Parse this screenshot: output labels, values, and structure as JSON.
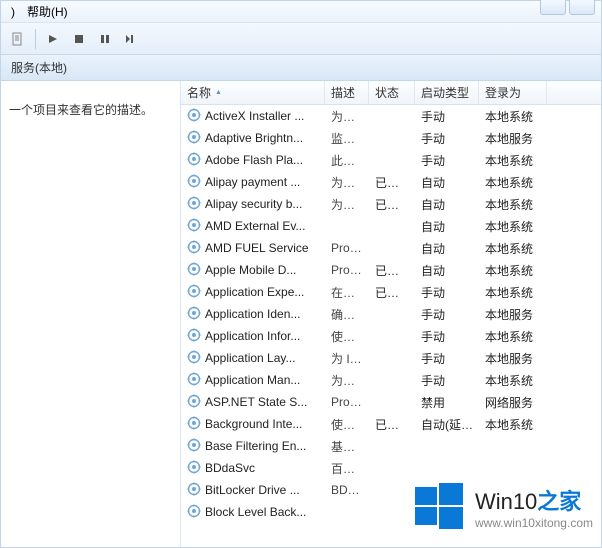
{
  "menu": {
    "item_right": ")",
    "help": "帮助(H)"
  },
  "toolbar": {
    "icons": [
      "doc-icon",
      "sep",
      "play-icon",
      "stop-icon",
      "pause-icon",
      "restart-icon"
    ]
  },
  "panel_title": "服务(本地)",
  "left_hint": "一个项目来查看它的描述。",
  "columns": {
    "name": "名称",
    "desc": "描述",
    "status": "状态",
    "startup": "启动类型",
    "logon": "登录为"
  },
  "services": [
    {
      "name": "ActiveX Installer ...",
      "desc": "为从...",
      "status": "",
      "startup": "手动",
      "logon": "本地系统"
    },
    {
      "name": "Adaptive Brightn...",
      "desc": "监视...",
      "status": "",
      "startup": "手动",
      "logon": "本地服务"
    },
    {
      "name": "Adobe Flash Pla...",
      "desc": "此服...",
      "status": "",
      "startup": "手动",
      "logon": "本地系统"
    },
    {
      "name": "Alipay payment ...",
      "desc": "为支...",
      "status": "已启动",
      "startup": "自动",
      "logon": "本地系统"
    },
    {
      "name": "Alipay security b...",
      "desc": "为支...",
      "status": "已启动",
      "startup": "自动",
      "logon": "本地系统"
    },
    {
      "name": "AMD External Ev...",
      "desc": "",
      "status": "",
      "startup": "自动",
      "logon": "本地系统"
    },
    {
      "name": "AMD FUEL Service",
      "desc": "Prov...",
      "status": "",
      "startup": "自动",
      "logon": "本地系统"
    },
    {
      "name": "Apple Mobile D...",
      "desc": "Prov...",
      "status": "已启动",
      "startup": "自动",
      "logon": "本地系统"
    },
    {
      "name": "Application Expe...",
      "desc": "在应...",
      "status": "已启动",
      "startup": "手动",
      "logon": "本地系统"
    },
    {
      "name": "Application Iden...",
      "desc": "确定...",
      "status": "",
      "startup": "手动",
      "logon": "本地服务"
    },
    {
      "name": "Application Infor...",
      "desc": "使用...",
      "status": "",
      "startup": "手动",
      "logon": "本地系统"
    },
    {
      "name": "Application Lay...",
      "desc": "为 In...",
      "status": "",
      "startup": "手动",
      "logon": "本地服务"
    },
    {
      "name": "Application Man...",
      "desc": "为通...",
      "status": "",
      "startup": "手动",
      "logon": "本地系统"
    },
    {
      "name": "ASP.NET State S...",
      "desc": "Prov...",
      "status": "",
      "startup": "禁用",
      "logon": "网络服务"
    },
    {
      "name": "Background Inte...",
      "desc": "使用...",
      "status": "已启动",
      "startup": "自动(延迟...",
      "logon": "本地系统"
    },
    {
      "name": "Base Filtering En...",
      "desc": "基本...",
      "status": "",
      "startup": "",
      "logon": ""
    },
    {
      "name": "BDdaSvc",
      "desc": "百度...",
      "status": "",
      "startup": "",
      "logon": ""
    },
    {
      "name": "BitLocker Drive ...",
      "desc": "BDE...",
      "status": "",
      "startup": "",
      "logon": ""
    },
    {
      "name": "Block Level Back...",
      "desc": "",
      "status": "",
      "startup": "",
      "logon": ""
    }
  ],
  "watermark": {
    "brand_prefix": "Win10",
    "brand_suffix": "之家",
    "url": "www.win10xitong.com"
  }
}
